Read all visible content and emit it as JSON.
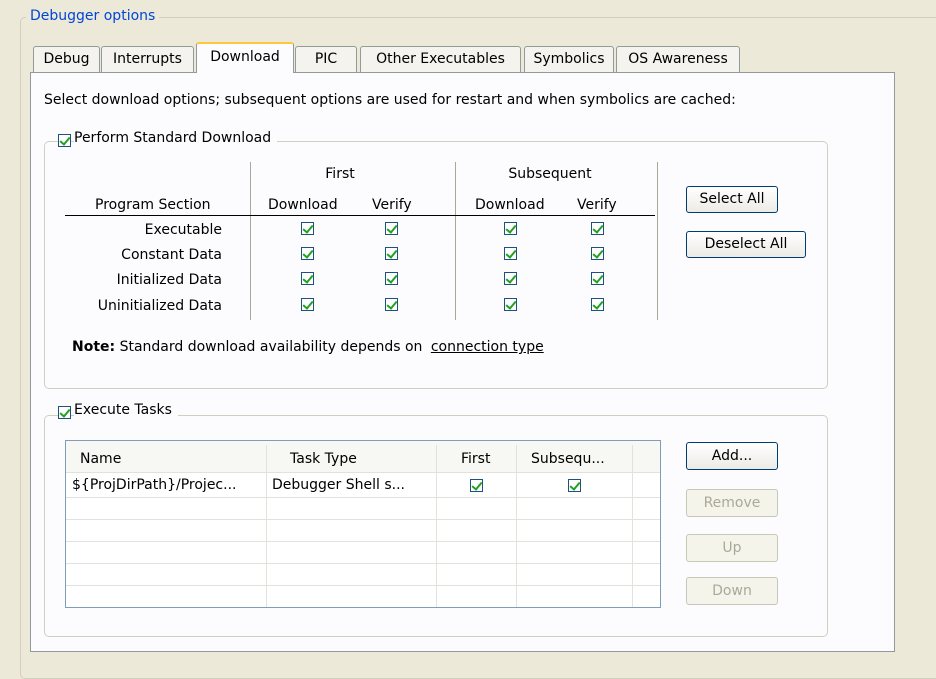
{
  "group_title": "Debugger options",
  "tabs": [
    {
      "label": "Debug",
      "active": false
    },
    {
      "label": "Interrupts",
      "active": false
    },
    {
      "label": "Download",
      "active": true
    },
    {
      "label": "PIC",
      "active": false
    },
    {
      "label": "Other Executables",
      "active": false
    },
    {
      "label": "Symbolics",
      "active": false
    },
    {
      "label": "OS Awareness",
      "active": false
    }
  ],
  "instructions": "Select download options; subsequent options are used for restart and when symbolics are cached:",
  "standard_download": {
    "checkbox_label": "Perform Standard Download",
    "checked": true,
    "header_first": "First",
    "header_subsequent": "Subsequent",
    "col_program_section": "Program Section",
    "col_download": "Download",
    "col_verify": "Verify",
    "rows": [
      {
        "section": "Executable",
        "first_download": true,
        "first_verify": true,
        "sub_download": true,
        "sub_verify": true
      },
      {
        "section": "Constant Data",
        "first_download": true,
        "first_verify": true,
        "sub_download": true,
        "sub_verify": true
      },
      {
        "section": "Initialized Data",
        "first_download": true,
        "first_verify": true,
        "sub_download": true,
        "sub_verify": true
      },
      {
        "section": "Uninitialized Data",
        "first_download": true,
        "first_verify": true,
        "sub_download": true,
        "sub_verify": true
      }
    ],
    "select_all": "Select All",
    "deselect_all": "Deselect All",
    "note_bold": "Note:",
    "note_text": "Standard download availability depends on",
    "note_link": "connection type"
  },
  "execute_tasks": {
    "checkbox_label": "Execute Tasks",
    "checked": true,
    "columns": [
      "Name",
      "Task Type",
      "First",
      "Subsequ..."
    ],
    "rows": [
      {
        "name": "${ProjDirPath}/Projec...",
        "task_type": "Debugger Shell s...",
        "first": true,
        "subsequent": true
      }
    ],
    "buttons": {
      "add": "Add...",
      "remove": "Remove",
      "up": "Up",
      "down": "Down"
    }
  }
}
